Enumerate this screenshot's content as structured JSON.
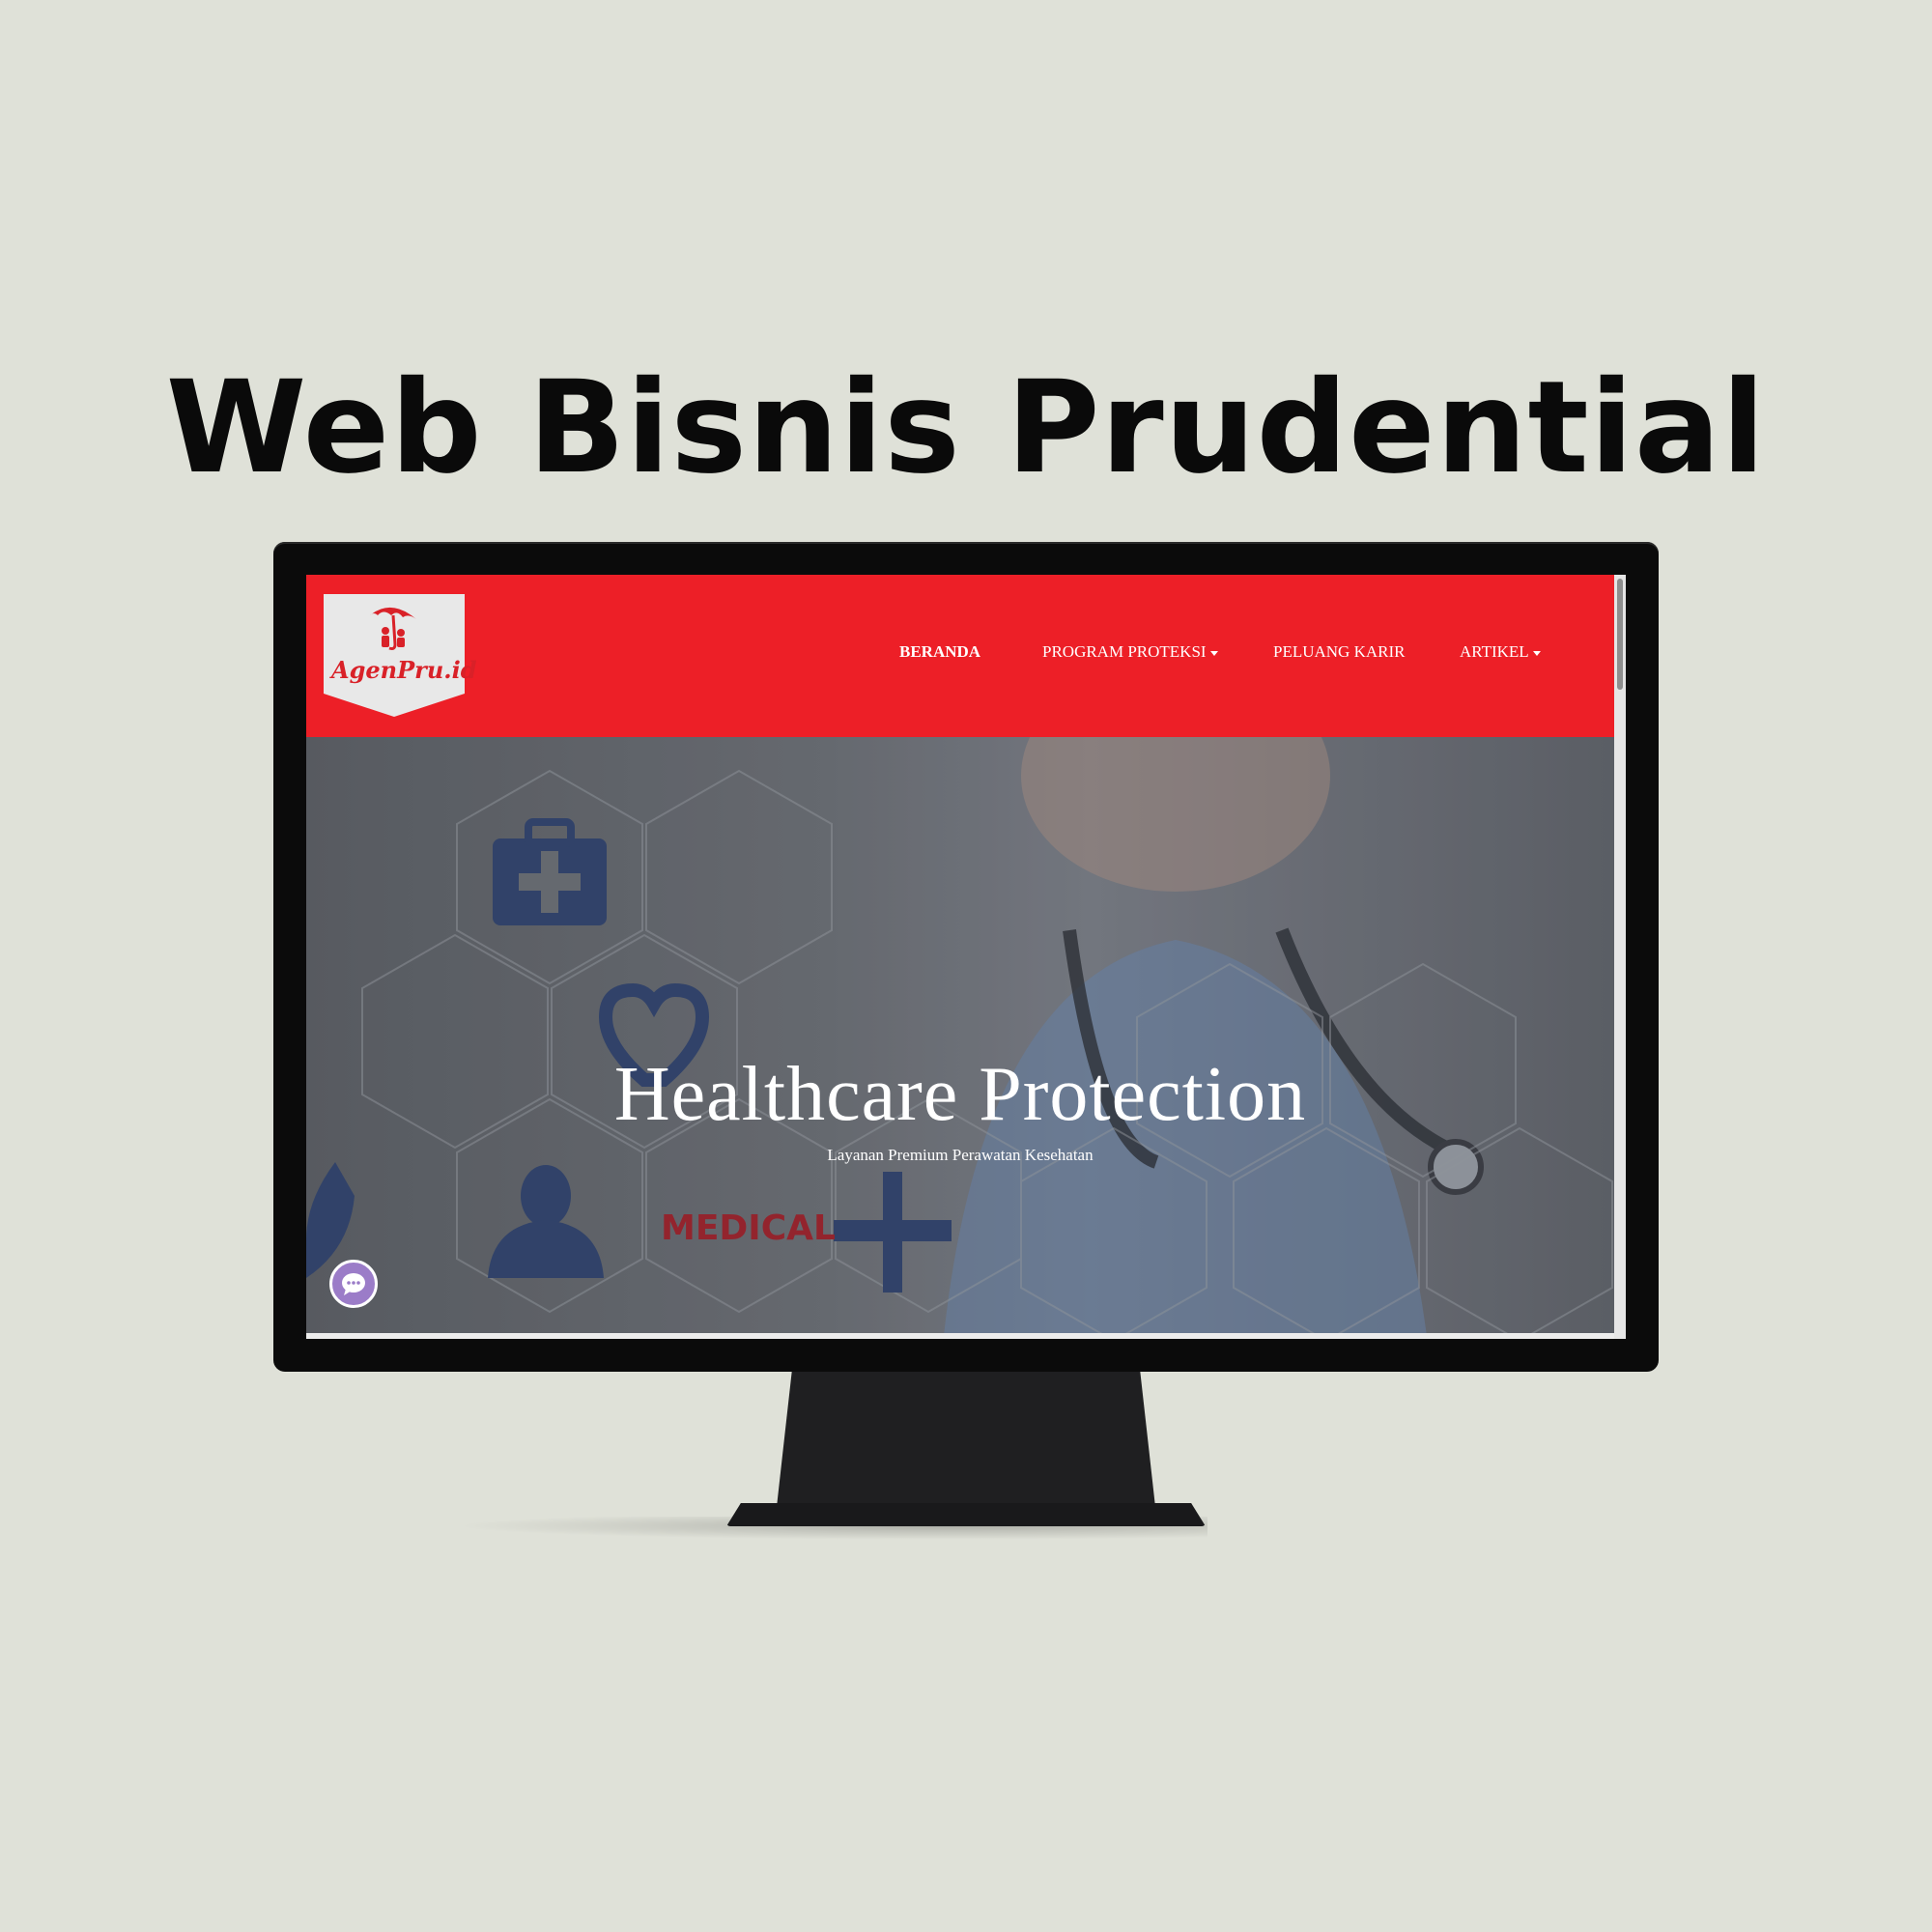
{
  "headline": "Web Bisnis Prudential",
  "site": {
    "logo": {
      "text": "AgenPru.id",
      "icon": "umbrella-family-icon"
    },
    "nav": {
      "items": [
        {
          "label": "BERANDA",
          "active": true,
          "dropdown": false
        },
        {
          "label": "PROGRAM PROTEKSI",
          "active": false,
          "dropdown": true
        },
        {
          "label": "PELUANG KARIR",
          "active": false,
          "dropdown": false
        },
        {
          "label": "ARTIKEL",
          "active": false,
          "dropdown": true
        }
      ]
    },
    "hero": {
      "title": "Healthcare Protection",
      "subtitle": "Layanan Premium Perawatan Kesehatan",
      "image_badge": "MEDICAL"
    },
    "chat_button": {
      "icon": "chat-bubble-icon"
    }
  },
  "colors": {
    "background": "#dfe1d8",
    "brand_red": "#ed1f27",
    "chat_purple": "#9b7cc8",
    "icon_navy": "#2f4470"
  }
}
